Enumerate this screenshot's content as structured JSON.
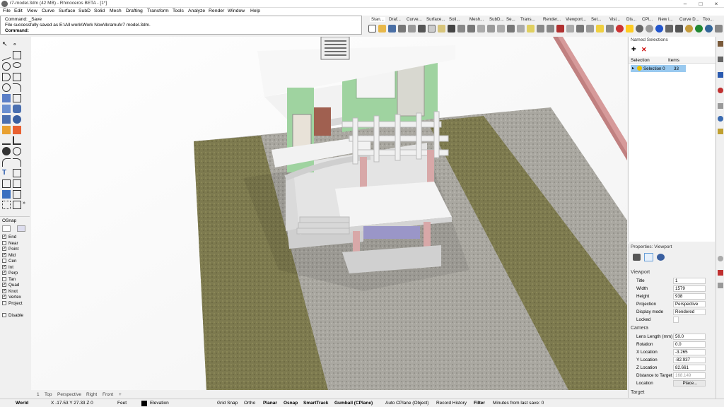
{
  "window": {
    "title": "r7-model.3dm (42 MB) - Rhinoceros BETA - [1*]",
    "minimize": "–",
    "maximize": "□",
    "close": "×"
  },
  "menu": [
    "File",
    "Edit",
    "View",
    "Curve",
    "Surface",
    "SubD",
    "Solid",
    "Mesh",
    "Drafting",
    "Transform",
    "Tools",
    "Analyze",
    "Render",
    "Window",
    "Help"
  ],
  "command": {
    "line1": "Command: _Save",
    "line2": "File successfully saved as E:\\All work\\Work Now\\Ikramul\\r7 model.3dm.",
    "prompt": "Command:"
  },
  "toolbar_tabs": [
    "Stan...",
    "Draf...",
    "Curve...",
    "Surface...",
    "Soli...",
    "Mesh...",
    "SubD...",
    "Se...",
    "Trans...",
    "Render...",
    "Viewport...",
    "Set...",
    "Visi...",
    "Dis...",
    "CPl...",
    "New i...",
    "Curve D...",
    "Too..."
  ],
  "viewport_tab": "1*",
  "osnap": {
    "title": "OSnap",
    "items": [
      {
        "label": "End",
        "checked": true
      },
      {
        "label": "Near",
        "checked": false
      },
      {
        "label": "Point",
        "checked": true
      },
      {
        "label": "Mid",
        "checked": true
      },
      {
        "label": "Cen",
        "checked": false
      },
      {
        "label": "Int",
        "checked": true
      },
      {
        "label": "Perp",
        "checked": true
      },
      {
        "label": "Tan",
        "checked": false
      },
      {
        "label": "Quad",
        "checked": true
      },
      {
        "label": "Knot",
        "checked": true
      },
      {
        "label": "Vertex",
        "checked": true
      },
      {
        "label": "Project",
        "checked": false
      },
      {
        "label": "Disable",
        "checked": false
      }
    ]
  },
  "named_selections": {
    "title": "Named Selections",
    "col_selection": "Selection",
    "col_items": "Items",
    "row_name": "Selection 0",
    "row_items": "33"
  },
  "properties": {
    "title": "Properties: Viewport",
    "section_viewport": "Viewport",
    "section_camera": "Camera",
    "section_target": "Target",
    "rows": [
      {
        "key": "Title",
        "value": "1"
      },
      {
        "key": "Width",
        "value": "1579"
      },
      {
        "key": "Height",
        "value": "938"
      },
      {
        "key": "Projection",
        "value": "Perspective"
      },
      {
        "key": "Display mode",
        "value": "Rendered"
      },
      {
        "key": "Locked",
        "value": ""
      }
    ],
    "camera_rows": [
      {
        "key": "Lens Length (mm)",
        "value": "50.0"
      },
      {
        "key": "Rotation",
        "value": "0.0"
      },
      {
        "key": "X Location",
        "value": "-3.265"
      },
      {
        "key": "Y Location",
        "value": "-82.937"
      },
      {
        "key": "Z Location",
        "value": "82.661"
      },
      {
        "key": "Distance to Target",
        "value": "168.149"
      },
      {
        "key": "Location",
        "value": "Place..."
      }
    ]
  },
  "view_tabs": [
    "1",
    "Top",
    "Perspective",
    "Right",
    "Front",
    "+"
  ],
  "status": {
    "cplane": "World",
    "coords": "X -17.53 Y 27.33 Z 0",
    "units": "Feet",
    "layer": "Elevation",
    "grid_snap": "Grid Snap",
    "ortho": "Ortho",
    "planar": "Planar",
    "osnap": "Osnap",
    "smarttrack": "SmartTrack",
    "gumball": "Gumball (CPlane)",
    "autocplane": "Auto CPlane (Object)",
    "record": "Record History",
    "filter": "Filter",
    "minutes": "Minutes from last save: 0"
  }
}
